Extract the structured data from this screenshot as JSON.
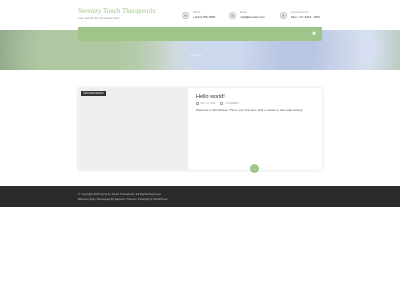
{
  "header": {
    "site_title": "Serenity Touch Therapeutix",
    "tagline": "Your search for an answer now",
    "contacts": [
      {
        "label": "Phone",
        "value": "+1(23) 456-7890",
        "icon": "phone-icon"
      },
      {
        "label": "Email",
        "value": "mail@domain.com",
        "icon": "email-icon"
      },
      {
        "label": "Opening Hours",
        "value": "Mon - Fri: 9AM - 7PM",
        "icon": "clock-icon"
      }
    ]
  },
  "hero": {
    "text": "Home  »"
  },
  "nav": {
    "search_icon": "✖"
  },
  "post": {
    "category": "UNCATEGORIZED",
    "title": "Hello world!",
    "date": "MAY 12, 2020",
    "comments": "1 COMMENT",
    "excerpt": "Welcome to WordPress. This is your first post. Edit or delete it, then start writing!",
    "read_more": "→"
  },
  "footer": {
    "line1": "© Copyright 2020 Serenity Touch Therapeutix. All Rights Reserved.",
    "line2": "Blossom Spa | Developed By Blossom Themes. Powered by WordPress."
  },
  "colors": {
    "accent": "#9fc58a",
    "footer_bg": "#2b2b2b"
  }
}
